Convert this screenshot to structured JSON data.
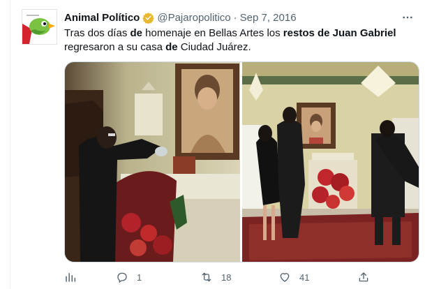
{
  "author": {
    "name": "Animal Político",
    "handle": "@Pajaropolitico",
    "date": "Sep 7, 2016",
    "verified": true
  },
  "tweet": {
    "text_parts": [
      {
        "t": "Tras dos días ",
        "bold": false
      },
      {
        "t": "de",
        "bold": true
      },
      {
        "t": " homenaje en Bellas Artes los ",
        "bold": false
      },
      {
        "t": "restos de Juan Gabriel",
        "bold": true
      },
      {
        "t": " regresaron a su casa ",
        "bold": false
      },
      {
        "t": "de",
        "bold": true
      },
      {
        "t": " Ciudad Juárez.",
        "bold": false
      }
    ]
  },
  "actions": {
    "reply_count": "1",
    "retweet_count": "18",
    "like_count": "41"
  },
  "icons": [
    "verified-badge-icon",
    "more-icon",
    "analytics-icon",
    "reply-icon",
    "retweet-icon",
    "like-icon",
    "share-icon"
  ],
  "colors": {
    "text": "#0f1419",
    "muted": "#536471",
    "verified": "#e8b92f",
    "border": "#cfd9de"
  }
}
